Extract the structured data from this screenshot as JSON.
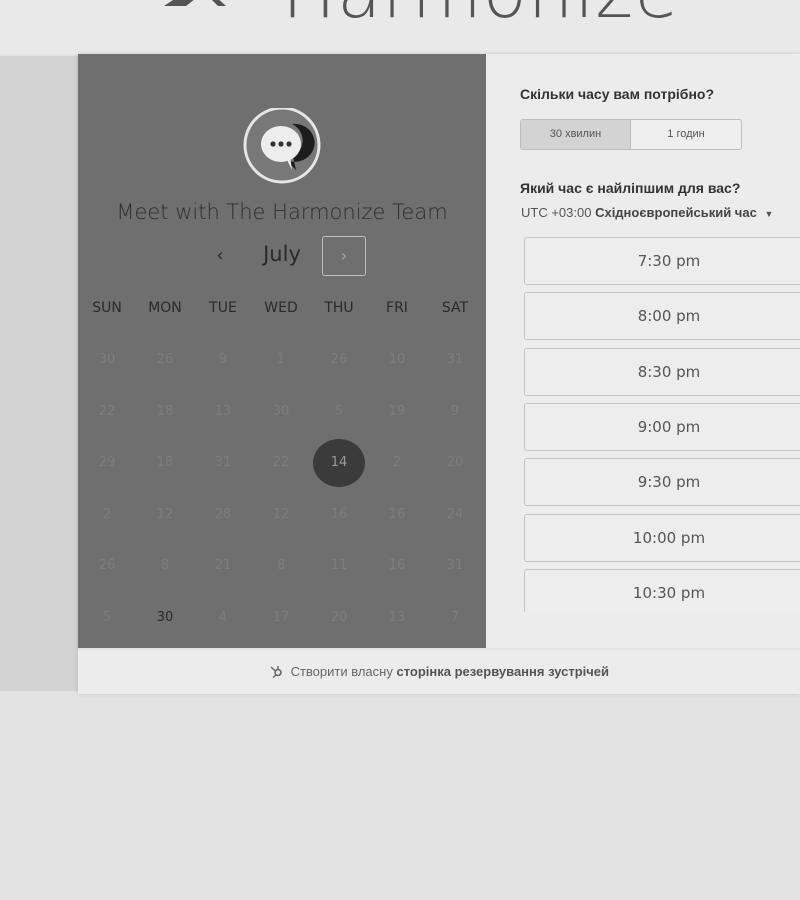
{
  "header": {
    "brand_text": "Harmonize"
  },
  "left": {
    "title": "Meet with The Harmonize Team",
    "month": "July",
    "prev_glyph": "‹",
    "next_glyph": "›",
    "avatar_icon": "chat-bubble-icon",
    "weekdays": [
      "SUN",
      "MON",
      "TUE",
      "WED",
      "THU",
      "FRI",
      "SAT"
    ],
    "weeks": [
      [
        "30",
        "26",
        "9",
        "1",
        "26",
        "10",
        "31"
      ],
      [
        "22",
        "18",
        "13",
        "30",
        "5",
        "19",
        "9"
      ],
      [
        "29",
        "18",
        "31",
        "22",
        "14",
        "2",
        "20"
      ],
      [
        "2",
        "12",
        "28",
        "12",
        "16",
        "16",
        "24"
      ],
      [
        "26",
        "8",
        "21",
        "8",
        "11",
        "16",
        "31"
      ],
      [
        "5",
        "30",
        "4",
        "17",
        "20",
        "13",
        "7"
      ]
    ],
    "selected_day": "14",
    "available_day": "30"
  },
  "right": {
    "duration_question": "Скільки часу вам потрібно?",
    "durations": [
      "30 хвилин",
      "1 годин"
    ],
    "selected_duration": "30 хвилин",
    "time_question": "Який час є найліпшим для вас?",
    "timezone_prefix": "UTC +03:00",
    "timezone_name": "Східноєвропейський час",
    "timezone_caret": "▼",
    "slots": [
      "7:30 pm",
      "8:00 pm",
      "8:30 pm",
      "9:00 pm",
      "9:30 pm",
      "10:00 pm",
      "10:30 pm"
    ]
  },
  "footer": {
    "prefix": "Створити власну",
    "link": "сторінка резервування зустрічей",
    "icon": "hubspot-sprocket-icon"
  }
}
